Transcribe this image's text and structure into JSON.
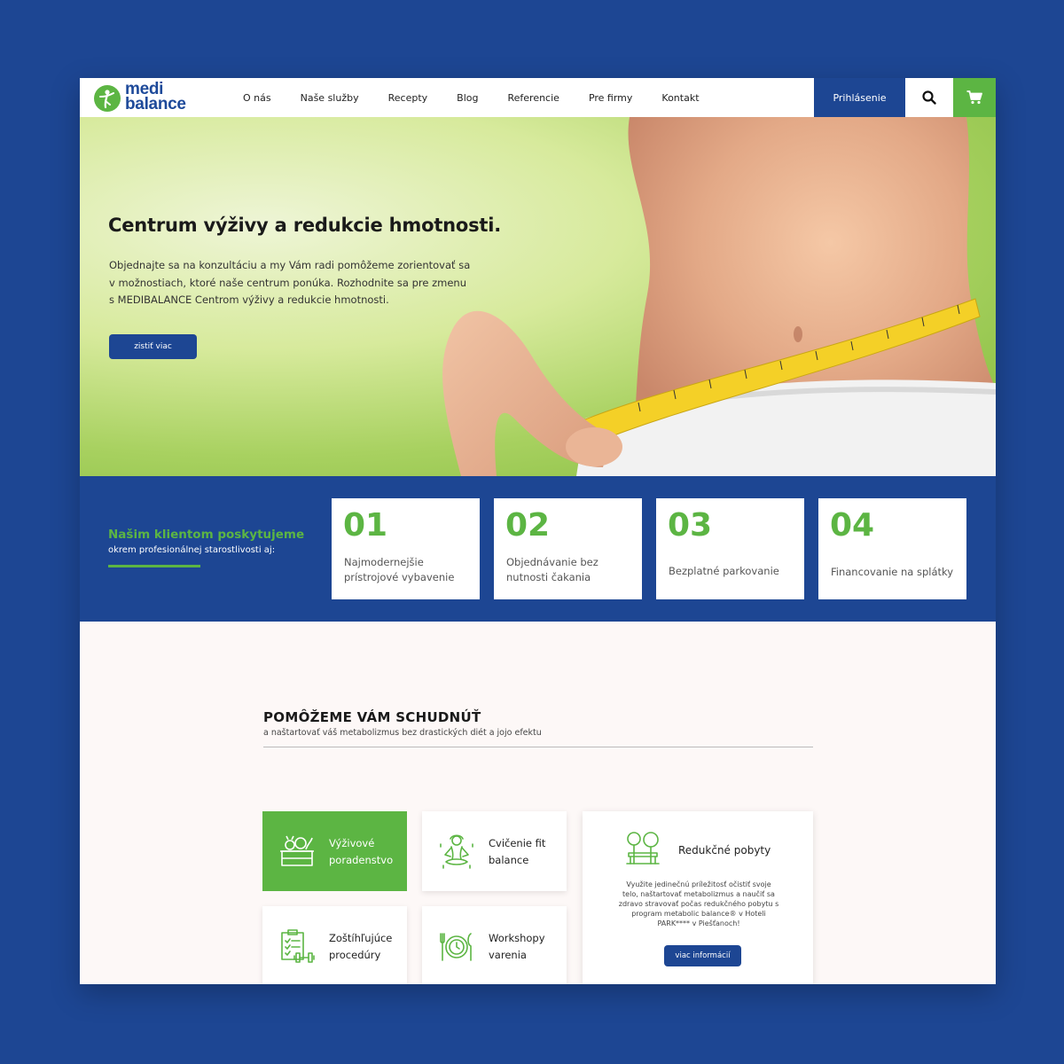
{
  "brand": {
    "line1": "medi",
    "line2": "balance"
  },
  "nav": {
    "items": [
      "O nás",
      "Naše služby",
      "Recepty",
      "Blog",
      "Referencie",
      "Pre firmy",
      "Kontakt"
    ],
    "login": "Prihlásenie"
  },
  "hero": {
    "title": "Centrum výživy a redukcie hmotnosti.",
    "text": "Objednajte sa na konzultáciu a my Vám radi pomôžeme zorientovať sa v možnostiach, ktoré naše centrum ponúka. Rozhodnite sa pre zmenu s MEDIBALANCE Centrom výživy a redukcie hmotnosti.",
    "button": "zistiť viac"
  },
  "benefits": {
    "title": "Našim klientom poskytujeme",
    "subtitle": "okrem profesionálnej starostlivosti aj:",
    "cards": [
      {
        "number": "01",
        "text": "Najmodernejšie prístrojové vybavenie"
      },
      {
        "number": "02",
        "text": "Objednávanie bez nutnosti čakania"
      },
      {
        "number": "03",
        "text": "Bezplatné parkovanie"
      },
      {
        "number": "04",
        "text": "Financovanie na splátky"
      }
    ]
  },
  "services": {
    "title": "POMÔŽEME VÁM SCHUDNÚŤ",
    "subtitle": "a naštartovať váš metabolizmus bez drastických diét a jojo efektu",
    "items": [
      {
        "label": "Výživové poradenstvo",
        "icon": "vegetable-crate-icon",
        "active": true
      },
      {
        "label": "Cvičenie fit balance",
        "icon": "yoga-icon",
        "active": false
      },
      {
        "label": "Zoštíhľujúce procedúry",
        "icon": "clipboard-dumbbell-icon",
        "active": false
      },
      {
        "label": "Workshopy varenia",
        "icon": "plate-cutlery-icon",
        "active": false
      }
    ],
    "featured": {
      "title": "Redukčné pobyty",
      "text": "Využite jedinečnú príležitosť očistiť svoje telo, naštartovať metabolizmus a naučiť sa zdravo stravovať počas redukčného pobytu s program metabolic balance® v Hoteli PARK**** v Piešťanoch!",
      "button": "viac informácií",
      "icon": "park-bench-icon"
    }
  },
  "colors": {
    "primary": "#1d4693",
    "accent": "#5cb543"
  }
}
